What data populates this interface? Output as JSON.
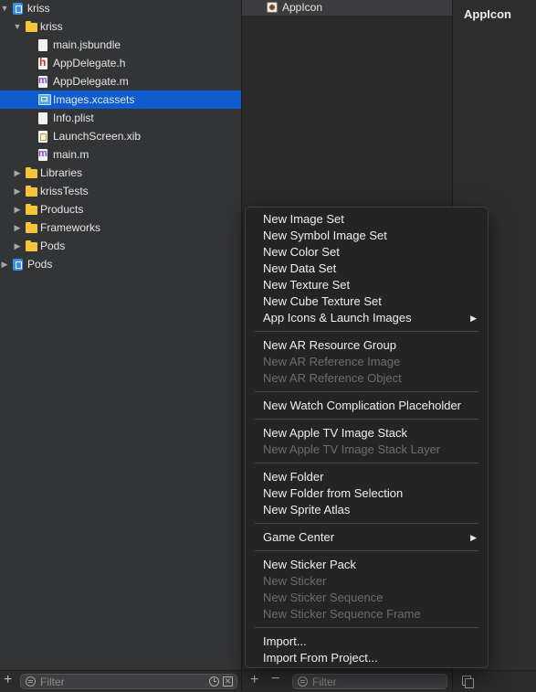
{
  "navigator": {
    "items": [
      {
        "label": "kriss",
        "icon": "project-icon",
        "expanded": true,
        "level": 0
      },
      {
        "label": "kriss",
        "icon": "folder-icon",
        "expanded": true,
        "level": 1
      },
      {
        "label": "main.jsbundle",
        "icon": "file-icon",
        "level": 2
      },
      {
        "label": "AppDelegate.h",
        "icon": "header-file-icon",
        "level": 2
      },
      {
        "label": "AppDelegate.m",
        "icon": "objc-file-icon",
        "level": 2
      },
      {
        "label": "Images.xcassets",
        "icon": "asset-catalog-icon",
        "level": 2,
        "selected": true
      },
      {
        "label": "Info.plist",
        "icon": "file-icon",
        "level": 2
      },
      {
        "label": "LaunchScreen.xib",
        "icon": "xib-file-icon",
        "level": 2
      },
      {
        "label": "main.m",
        "icon": "objc-file-icon",
        "level": 2
      },
      {
        "label": "Libraries",
        "icon": "folder-icon",
        "expanded": false,
        "level": 1
      },
      {
        "label": "krissTests",
        "icon": "folder-icon",
        "expanded": false,
        "level": 1
      },
      {
        "label": "Products",
        "icon": "folder-icon",
        "expanded": false,
        "level": 1
      },
      {
        "label": "Frameworks",
        "icon": "folder-icon",
        "expanded": false,
        "level": 1
      },
      {
        "label": "Pods",
        "icon": "folder-icon",
        "expanded": false,
        "level": 1
      },
      {
        "label": "Pods",
        "icon": "project-icon",
        "expanded": false,
        "level": 0
      }
    ],
    "filter_placeholder": "Filter"
  },
  "asset_list": {
    "items": [
      {
        "label": "AppIcon"
      }
    ],
    "filter_placeholder": "Filter",
    "add_symbol": "+",
    "remove_symbol": "−"
  },
  "editor": {
    "title": "AppIcon"
  },
  "context_menu": {
    "groups": [
      [
        {
          "label": "New Image Set",
          "enabled": true
        },
        {
          "label": "New Symbol Image Set",
          "enabled": true
        },
        {
          "label": "New Color Set",
          "enabled": true
        },
        {
          "label": "New Data Set",
          "enabled": true
        },
        {
          "label": "New Texture Set",
          "enabled": true
        },
        {
          "label": "New Cube Texture Set",
          "enabled": true
        },
        {
          "label": "App Icons & Launch Images",
          "enabled": true,
          "submenu": true
        }
      ],
      [
        {
          "label": "New AR Resource Group",
          "enabled": true
        },
        {
          "label": "New AR Reference Image",
          "enabled": false
        },
        {
          "label": "New AR Reference Object",
          "enabled": false
        }
      ],
      [
        {
          "label": "New Watch Complication Placeholder",
          "enabled": true
        }
      ],
      [
        {
          "label": "New Apple TV Image Stack",
          "enabled": true
        },
        {
          "label": "New Apple TV Image Stack Layer",
          "enabled": false
        }
      ],
      [
        {
          "label": "New Folder",
          "enabled": true
        },
        {
          "label": "New Folder from Selection",
          "enabled": true
        },
        {
          "label": "New Sprite Atlas",
          "enabled": true
        }
      ],
      [
        {
          "label": "Game Center",
          "enabled": true,
          "submenu": true
        }
      ],
      [
        {
          "label": "New Sticker Pack",
          "enabled": true
        },
        {
          "label": "New Sticker",
          "enabled": false
        },
        {
          "label": "New Sticker Sequence",
          "enabled": false
        },
        {
          "label": "New Sticker Sequence Frame",
          "enabled": false
        }
      ],
      [
        {
          "label": "Import...",
          "enabled": true
        },
        {
          "label": "Import From Project...",
          "enabled": true
        }
      ]
    ]
  },
  "colors": {
    "selection": "#0f5cce",
    "folder": "#f6c33a",
    "menu_bg": "#242424",
    "disabled_text": "#6c6c6c"
  }
}
